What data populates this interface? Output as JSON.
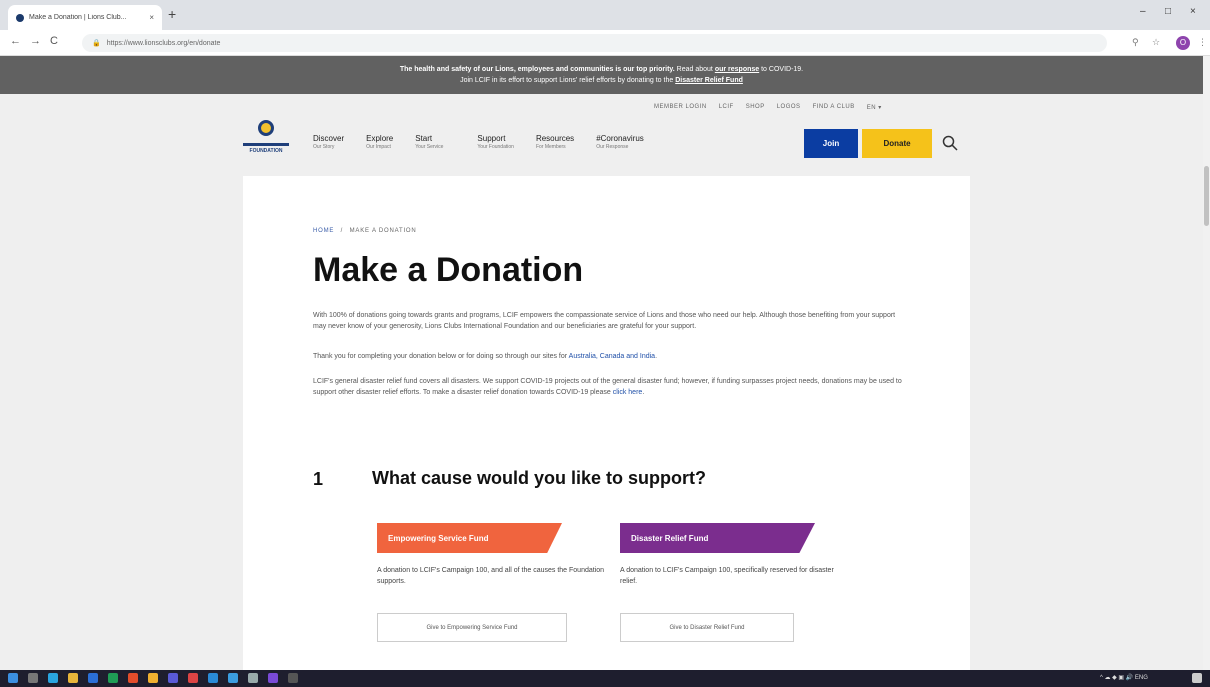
{
  "browser": {
    "tab_title": "Make a Donation | Lions Club...",
    "tab_close": "×",
    "new_tab": "+",
    "url": "https://www.lionsclubs.org/en/donate",
    "back": "←",
    "forward": "→",
    "reload": "C",
    "minimize": "–",
    "maximize": "□",
    "close": "×",
    "profile_initial": "O"
  },
  "alert": {
    "line1_bold": "The health and safety of our Lions, employees and communities is our top priority.",
    "line1_rest": " Read about ",
    "line1_link": "our response",
    "line1_end": " to COVID-19.",
    "line2": "Join LCIF in its effort to support Lions' relief efforts by donating to the ",
    "line2_link": "Disaster Relief Fund"
  },
  "top_links": [
    "MEMBER LOGIN",
    "LCIF",
    "SHOP",
    "LOGOS",
    "FIND A CLUB",
    "EN ▾"
  ],
  "logo": {
    "wordmark": "FOUNDATION"
  },
  "nav": [
    {
      "title": "Discover",
      "sub": "Our Story"
    },
    {
      "title": "Explore",
      "sub": "Our Impact"
    },
    {
      "title": "Start",
      "sub": "Your Service"
    },
    {
      "title": "Support",
      "sub": "Your Foundation"
    },
    {
      "title": "Resources",
      "sub": "For Members"
    },
    {
      "title": "#Coronavirus",
      "sub": "Our Response"
    }
  ],
  "buttons": {
    "join": "Join",
    "donate": "Donate"
  },
  "breadcrumb": {
    "home": "HOME",
    "sep": "/",
    "current": "MAKE A DONATION"
  },
  "page": {
    "title": "Make a Donation",
    "p1": "With 100% of donations going towards grants and programs, LCIF empowers the compassionate service of Lions and those who need our help. Although those benefiting from your support may never know of your generosity, Lions Clubs International Foundation and our beneficiaries are grateful for your support.",
    "p2_text": "Thank you for completing your donation below or for doing so through our sites for ",
    "p2_links": "Australia, Canada and India",
    "p2_end": ".",
    "p3_text": "LCIF's general disaster relief fund covers all disasters. We support COVID-19 projects out of the general disaster fund; however, if funding surpasses project needs, donations may be used to support other disaster relief efforts. To make a disaster relief donation towards COVID-19 please ",
    "p3_link": "click here",
    "p3_end": "."
  },
  "step": {
    "number": "1",
    "title": "What cause would you like to support?"
  },
  "funds": [
    {
      "tag": "Empowering Service Fund",
      "color": "#f0643e",
      "desc": "A donation to LCIF's Campaign 100, and all of the causes the Foundation supports.",
      "button": "Give to Empowering Service Fund"
    },
    {
      "tag": "Disaster Relief Fund",
      "color": "#7b2d8e",
      "desc": "A donation to LCIF's Campaign 100, specifically reserved for disaster relief.",
      "button": "Give to Disaster Relief Fund"
    }
  ],
  "taskbar": {
    "tray_text": "^ ☁ ◆ ▣ 🔊 ENG"
  }
}
